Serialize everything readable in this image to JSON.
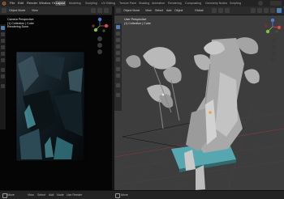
{
  "topbar": {
    "menus": [
      "File",
      "Edit",
      "Render",
      "Window",
      "Help"
    ],
    "workspaces": [
      "Layout",
      "Modeling",
      "Sculpting",
      "UV Editing",
      "Texture Paint",
      "Shading",
      "Animation",
      "Rendering",
      "Compositing",
      "Geometry Nodes",
      "Scripting"
    ],
    "active_workspace": "Layout"
  },
  "left_panel": {
    "header": {
      "editor_type": "Object Mode",
      "view": "View"
    },
    "info_lines": [
      "Camera Perspective",
      "(1) Collection | Cube",
      "Rendering Done"
    ]
  },
  "right_panel": {
    "header": {
      "mode": "Object Mode",
      "menus": [
        "View",
        "Select",
        "Add",
        "Object"
      ],
      "transform": "Global",
      "options": "Options"
    },
    "info_lines": [
      "User Perspective",
      "(1) Collection | Cube"
    ]
  },
  "statusbar": {
    "left": [
      "Move",
      "View",
      "Select",
      "Add",
      "Node",
      "Use Render"
    ],
    "right": [
      "Move"
    ]
  },
  "colors": {
    "accent": "#4f7fb7",
    "axis_x": "#d94a4a",
    "axis_y": "#7fbf3f",
    "axis_z": "#4a7ee0"
  }
}
